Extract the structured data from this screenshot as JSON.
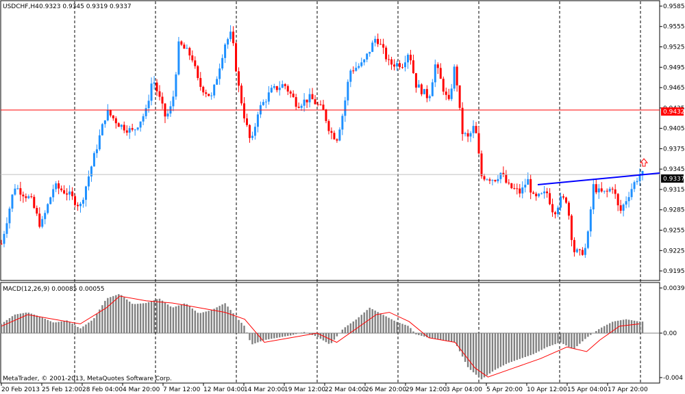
{
  "header": {
    "symbol_timeframe": "USDCHF,H4",
    "ohlc": "0.9323 0.9345 0.9319 0.9337"
  },
  "macd": {
    "title": "MACD(12,26,9) 0.00085 0.00055",
    "y_ticks": [
      "0.00396",
      "0.00",
      "-0.004"
    ]
  },
  "copyright": "MetaTrader, © 2001-2013, MetaQuotes Software Corp.",
  "colors": {
    "bull": "#1e90ff",
    "bear": "#ff0000",
    "horizontal_line": "#ff0000",
    "trend_line": "#0000ff",
    "histogram": "#808080",
    "signal": "#ff0000",
    "arrow": "#ff0000"
  },
  "lines": {
    "red_level": "0.9432",
    "current_price": "0.9337"
  },
  "chart_data": [
    {
      "type": "candlestick",
      "title": "USDCHF,H4",
      "y_ticks": [
        "0.9585",
        "0.9555",
        "0.9525",
        "0.9495",
        "0.9465",
        "0.9435",
        "0.9405",
        "0.9375",
        "0.9345",
        "0.9315",
        "0.9285",
        "0.9255",
        "0.9225",
        "0.9195"
      ],
      "ylim": [
        0.9185,
        0.959
      ],
      "x_ticks": [
        "20 Feb 2013",
        "25 Feb 12:00",
        "28 Feb 04:00",
        "4 Mar 20:00",
        "7 Mar 12:00",
        "12 Mar 04:00",
        "14 Mar 20:00",
        "19 Mar 12:00",
        "22 Mar 04:00",
        "26 Mar 20:00",
        "29 Mar 12:00",
        "3 Apr 04:00",
        "5 Apr 20:00",
        "10 Apr 12:00",
        "15 Apr 04:00",
        "17 Apr 20:00"
      ],
      "close_path": [
        [
          0,
          0.9235
        ],
        [
          0.02,
          0.932
        ],
        [
          0.045,
          0.93
        ],
        [
          0.06,
          0.926
        ],
        [
          0.08,
          0.932
        ],
        [
          0.1,
          0.931
        ],
        [
          0.12,
          0.929
        ],
        [
          0.14,
          0.936
        ],
        [
          0.16,
          0.943
        ],
        [
          0.18,
          0.941
        ],
        [
          0.2,
          0.94
        ],
        [
          0.22,
          0.943
        ],
        [
          0.23,
          0.948
        ],
        [
          0.25,
          0.942
        ],
        [
          0.26,
          0.944
        ],
        [
          0.27,
          0.953
        ],
        [
          0.29,
          0.951
        ],
        [
          0.3,
          0.947
        ],
        [
          0.32,
          0.945
        ],
        [
          0.34,
          0.953
        ],
        [
          0.35,
          0.9545
        ],
        [
          0.36,
          0.947
        ],
        [
          0.37,
          0.942
        ],
        [
          0.38,
          0.938
        ],
        [
          0.39,
          0.943
        ],
        [
          0.41,
          0.946
        ],
        [
          0.43,
          0.947
        ],
        [
          0.45,
          0.944
        ],
        [
          0.47,
          0.945
        ],
        [
          0.49,
          0.943
        ],
        [
          0.5,
          0.94
        ],
        [
          0.51,
          0.939
        ],
        [
          0.52,
          0.943
        ],
        [
          0.53,
          0.949
        ],
        [
          0.55,
          0.95
        ],
        [
          0.57,
          0.954
        ],
        [
          0.58,
          0.952
        ],
        [
          0.59,
          0.95
        ],
        [
          0.61,
          0.95
        ],
        [
          0.62,
          0.952
        ],
        [
          0.63,
          0.947
        ],
        [
          0.65,
          0.945
        ],
        [
          0.66,
          0.95
        ],
        [
          0.67,
          0.947
        ],
        [
          0.68,
          0.944
        ],
        [
          0.69,
          0.95
        ],
        [
          0.7,
          0.94
        ],
        [
          0.71,
          0.939
        ],
        [
          0.72,
          0.941
        ],
        [
          0.73,
          0.9335
        ],
        [
          0.75,
          0.933
        ],
        [
          0.76,
          0.934
        ],
        [
          0.77,
          0.932
        ],
        [
          0.79,
          0.931
        ],
        [
          0.8,
          0.933
        ],
        [
          0.81,
          0.93
        ],
        [
          0.83,
          0.931
        ],
        [
          0.84,
          0.928
        ],
        [
          0.85,
          0.93
        ],
        [
          0.86,
          0.93
        ],
        [
          0.87,
          0.9225
        ],
        [
          0.88,
          0.922
        ],
        [
          0.89,
          0.923
        ],
        [
          0.9,
          0.932
        ],
        [
          0.91,
          0.931
        ],
        [
          0.92,
          0.931
        ],
        [
          0.93,
          0.932
        ],
        [
          0.94,
          0.928
        ],
        [
          0.95,
          0.93
        ],
        [
          0.96,
          0.932
        ],
        [
          0.97,
          0.9337
        ]
      ]
    },
    {
      "type": "bar",
      "title": "MACD(12,26,9)",
      "ylim": [
        -0.0042,
        0.0042
      ],
      "histogram_path": [
        [
          0,
          0.0008
        ],
        [
          0.02,
          0.0016
        ],
        [
          0.04,
          0.0018
        ],
        [
          0.06,
          0.0014
        ],
        [
          0.08,
          0.0009
        ],
        [
          0.1,
          0.0011
        ],
        [
          0.12,
          0.0004
        ],
        [
          0.14,
          0.0012
        ],
        [
          0.16,
          0.003
        ],
        [
          0.18,
          0.0034
        ],
        [
          0.2,
          0.0025
        ],
        [
          0.22,
          0.0026
        ],
        [
          0.24,
          0.003
        ],
        [
          0.26,
          0.0022
        ],
        [
          0.28,
          0.0026
        ],
        [
          0.3,
          0.0017
        ],
        [
          0.32,
          0.002
        ],
        [
          0.34,
          0.0026
        ],
        [
          0.36,
          0.0012
        ],
        [
          0.37,
          0.0006
        ],
        [
          0.38,
          -0.001
        ],
        [
          0.4,
          -0.0006
        ],
        [
          0.42,
          -0.0004
        ],
        [
          0.44,
          -0.0002
        ],
        [
          0.46,
          0.0001
        ],
        [
          0.48,
          -0.0003
        ],
        [
          0.5,
          -0.001
        ],
        [
          0.52,
          0.0004
        ],
        [
          0.54,
          0.0012
        ],
        [
          0.56,
          0.0022
        ],
        [
          0.58,
          0.0016
        ],
        [
          0.6,
          0.001
        ],
        [
          0.62,
          0.0006
        ],
        [
          0.63,
          -0.0001
        ],
        [
          0.65,
          -0.0004
        ],
        [
          0.67,
          -0.0006
        ],
        [
          0.69,
          -0.0008
        ],
        [
          0.71,
          -0.003
        ],
        [
          0.73,
          -0.004
        ],
        [
          0.75,
          -0.0032
        ],
        [
          0.77,
          -0.0026
        ],
        [
          0.79,
          -0.0022
        ],
        [
          0.81,
          -0.0018
        ],
        [
          0.83,
          -0.0012
        ],
        [
          0.85,
          -0.0008
        ],
        [
          0.87,
          -0.0014
        ],
        [
          0.89,
          -0.0004
        ],
        [
          0.91,
          0.0004
        ],
        [
          0.93,
          0.001
        ],
        [
          0.95,
          0.0012
        ],
        [
          0.97,
          0.001
        ]
      ],
      "signal_path": [
        [
          0,
          0.0006
        ],
        [
          0.04,
          0.0016
        ],
        [
          0.08,
          0.0012
        ],
        [
          0.12,
          0.0008
        ],
        [
          0.16,
          0.0022
        ],
        [
          0.18,
          0.0032
        ],
        [
          0.22,
          0.0028
        ],
        [
          0.26,
          0.0026
        ],
        [
          0.3,
          0.0022
        ],
        [
          0.34,
          0.0018
        ],
        [
          0.37,
          0.0012
        ],
        [
          0.4,
          -0.0008
        ],
        [
          0.44,
          -0.0004
        ],
        [
          0.48,
          0.0
        ],
        [
          0.51,
          -0.0008
        ],
        [
          0.53,
          0.0
        ],
        [
          0.57,
          0.0016
        ],
        [
          0.59,
          0.0018
        ],
        [
          0.62,
          0.001
        ],
        [
          0.65,
          -0.0004
        ],
        [
          0.69,
          -0.0008
        ],
        [
          0.72,
          -0.003
        ],
        [
          0.74,
          -0.0038
        ],
        [
          0.78,
          -0.003
        ],
        [
          0.82,
          -0.0022
        ],
        [
          0.86,
          -0.0012
        ],
        [
          0.89,
          -0.0016
        ],
        [
          0.91,
          -0.0006
        ],
        [
          0.94,
          0.0006
        ],
        [
          0.97,
          0.0008
        ]
      ]
    }
  ]
}
